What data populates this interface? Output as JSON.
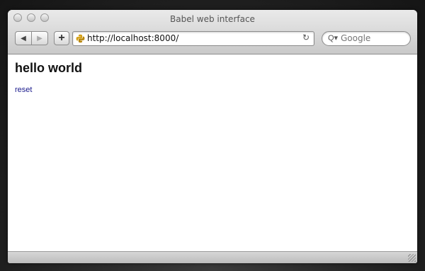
{
  "window": {
    "title": "Babel web interface"
  },
  "toolbar": {
    "back_icon": "◀",
    "forward_icon": "▶",
    "add_icon": "+",
    "url": "http://localhost:8000/",
    "reload_icon": "↻",
    "search_icon": "Q▾",
    "search_placeholder": "Google"
  },
  "page": {
    "heading": "hello world",
    "link_text": "reset"
  }
}
